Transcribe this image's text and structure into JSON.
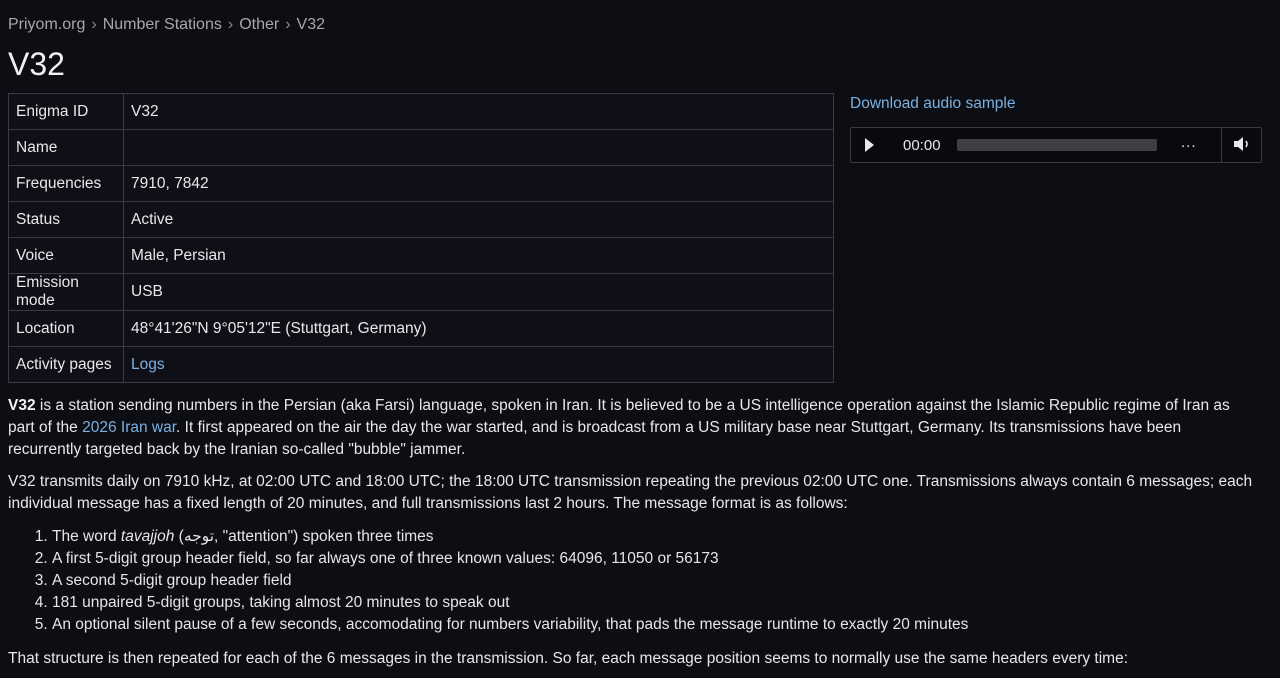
{
  "breadcrumb": {
    "items": [
      "Priyom.org",
      "Number Stations",
      "Other",
      "V32"
    ],
    "separator": "›"
  },
  "page_title": "V32",
  "info_table": [
    {
      "key": "Enigma ID",
      "value": "V32"
    },
    {
      "key": "Name",
      "value": ""
    },
    {
      "key": "Frequencies",
      "value": "7910, 7842"
    },
    {
      "key": "Status",
      "value": "Active"
    },
    {
      "key": "Voice",
      "value": "Male, Persian"
    },
    {
      "key": "Emission mode",
      "value": "USB"
    },
    {
      "key": "Location",
      "value": "48°41'26\"N 9°05'12\"E (Stuttgart, Germany)"
    },
    {
      "key": "Activity pages",
      "value": "Logs"
    }
  ],
  "audio": {
    "download_label": "Download audio sample",
    "time": "00:00",
    "more": "...",
    "progress": 0
  },
  "paragraph1": {
    "bold": "V32",
    "text_a": " is a station sending numbers in the Persian (aka Farsi) language, spoken in Iran. It is believed to be a US intelligence operation against the Islamic Republic regime of Iran as part of the ",
    "link": "2026 Iran war",
    "text_b": ". It first appeared on the air the day the war started, and is broadcast from a US military base near Stuttgart, Germany. Its transmissions have been recurrently targeted back by the Iranian so-called \"bubble\" jammer."
  },
  "paragraph2": "V32 transmits daily on 7910 kHz, at 02:00 UTC and 18:00 UTC; the 18:00 UTC transmission repeating the previous 02:00 UTC one. Transmissions always contain 6 messages; each individual message has a fixed length of 20 minutes, and full transmissions last 2 hours. The message format is as follows:",
  "steps": {
    "first_a": "The word ",
    "first_italic": "tavajjoh",
    "first_b": " (توجه, \"attention\") spoken three times",
    "items": [
      "A first 5-digit group header field, so far always one of three known values: 64096, 11050 or 56173",
      "A second 5-digit group header field",
      "181 unpaired 5-digit groups, taking almost 20 minutes to speak out",
      "An optional silent pause of a few seconds, accomodating for numbers variability, that pads the message runtime to exactly 20 minutes"
    ]
  },
  "paragraph3": "That structure is then repeated for each of the 6 messages in the transmission. So far, each message position seems to normally use the same headers every time:"
}
